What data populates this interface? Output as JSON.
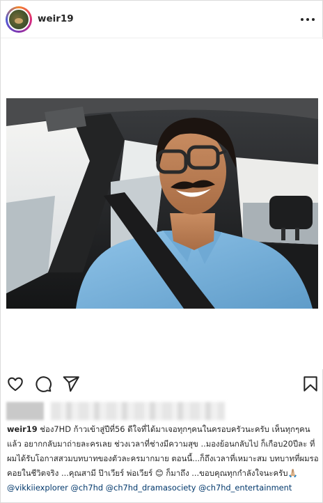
{
  "header": {
    "username": "weir19",
    "avatar_icon": "profile-avatar",
    "more_icon": "more-options-icon"
  },
  "actions": {
    "like_icon": "heart-icon",
    "comment_icon": "comment-icon",
    "share_icon": "share-icon",
    "save_icon": "bookmark-icon"
  },
  "caption": {
    "username": "weir19",
    "text_1": "ช่อง7HD ก้าวเข้าสู่ปีที่56 ดีใจที่ได้มาเจอทุกๆคนในครอบครัวนะครับ เห็นทุกๆคนแล้ว อยากกลับมาถ่ายละครเลย ช่วงเวลาที่ช่างมีความสุข ..มองย้อนกลับไป ก็เกือบ20ปีละ ที่ผมได้รับโอกาสสวมบทบาทของตัวละครมากมาย ตอนนี้...ก็ถึงเวลาที่เหมาะสม บทบาทที่ผมรอคอยในชีวิตจริง ...คุณสามี ป๊าเวียร์ พ่อเวียร์ 😊 ก็มาถึง ...ขอบคุณทุกกำลังใจนะครับ🙏🏼",
    "mentions": [
      "@vikkiiexplorer",
      "@ch7hd",
      "@ch7hd_dramasociety",
      "@ch7hd_entertainment"
    ]
  },
  "colors": {
    "text": "#262626",
    "mention": "#00376b",
    "divider": "#efefef",
    "border": "#dbdbdb"
  }
}
